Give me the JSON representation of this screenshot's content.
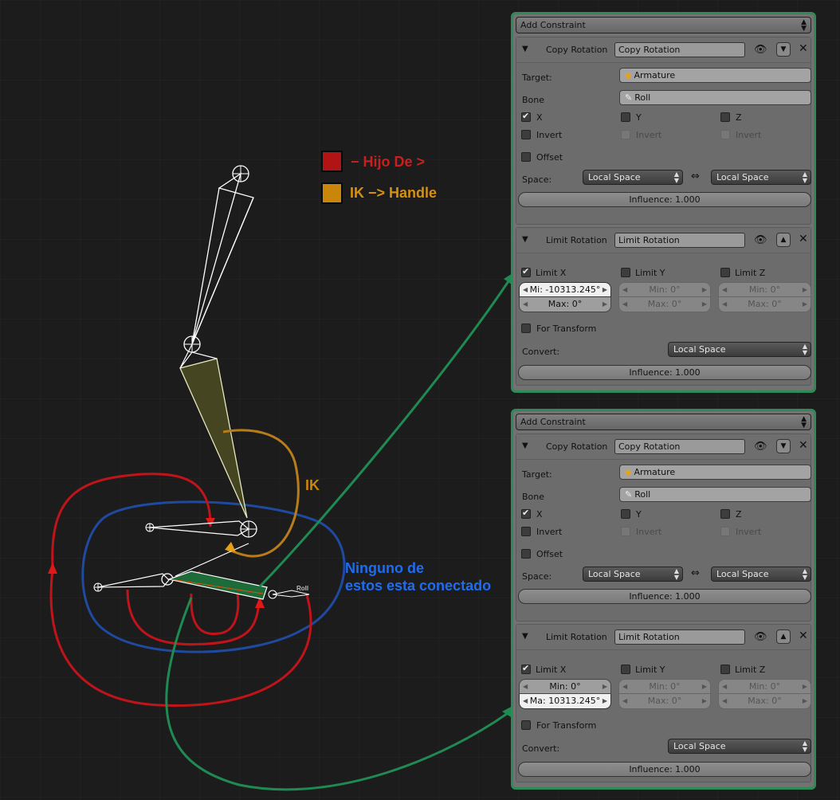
{
  "legend": [
    {
      "label": "− Hijo De >",
      "color": "#b01414",
      "text_color": "#c62020"
    },
    {
      "label": "IK −> Handle",
      "color": "#c9860a",
      "text_color": "#d8900f"
    }
  ],
  "annotations": {
    "ik": "IK",
    "none_line1": "Ninguno de",
    "none_line2": "estos esta conectado",
    "roll_tag": "Roll"
  },
  "colors": {
    "parent_curve": "#c0141a",
    "ik_curve": "#b87d1a",
    "group_outline": "#1f4aa0",
    "connector": "#1f8a52",
    "panel_border": "#2e8b57",
    "annotation_blue": "#1e6cf0"
  },
  "panels": [
    {
      "add_label": "Add Constraint",
      "copy": {
        "type": "Copy Rotation",
        "name": "Copy Rotation",
        "target_label": "Target:",
        "target": "Armature",
        "bone_label": "Bone",
        "bone": "Roll",
        "x": "X",
        "y": "Y",
        "z": "Z",
        "invert": "Invert",
        "offset": "Offset",
        "space_label": "Space:",
        "owner_space": "Local Space",
        "target_space": "Local Space",
        "influence": "Influence: 1.000"
      },
      "limit": {
        "type": "Limit Rotation",
        "name": "Limit Rotation",
        "limit_x": "Limit X",
        "limit_y": "Limit Y",
        "limit_z": "Limit Z",
        "x_min": "Mi: -10313.245°",
        "x_max": "Max: 0°",
        "y_min": "Min: 0°",
        "y_max": "Max: 0°",
        "z_min": "Min: 0°",
        "z_max": "Max: 0°",
        "for_transform": "For Transform",
        "convert_label": "Convert:",
        "convert": "Local Space",
        "influence": "Influence: 1.000"
      }
    },
    {
      "add_label": "Add Constraint",
      "copy": {
        "type": "Copy Rotation",
        "name": "Copy Rotation",
        "target_label": "Target:",
        "target": "Armature",
        "bone_label": "Bone",
        "bone": "Roll",
        "x": "X",
        "y": "Y",
        "z": "Z",
        "invert": "Invert",
        "offset": "Offset",
        "space_label": "Space:",
        "owner_space": "Local Space",
        "target_space": "Local Space",
        "influence": "Influence: 1.000"
      },
      "limit": {
        "type": "Limit Rotation",
        "name": "Limit Rotation",
        "limit_x": "Limit X",
        "limit_y": "Limit Y",
        "limit_z": "Limit Z",
        "x_min": "Min: 0°",
        "x_max": "Ma: 10313.245°",
        "y_min": "Min: 0°",
        "y_max": "Max: 0°",
        "z_min": "Min: 0°",
        "z_max": "Max: 0°",
        "for_transform": "For Transform",
        "convert_label": "Convert:",
        "convert": "Local Space",
        "influence": "Influence: 1.000"
      }
    }
  ]
}
